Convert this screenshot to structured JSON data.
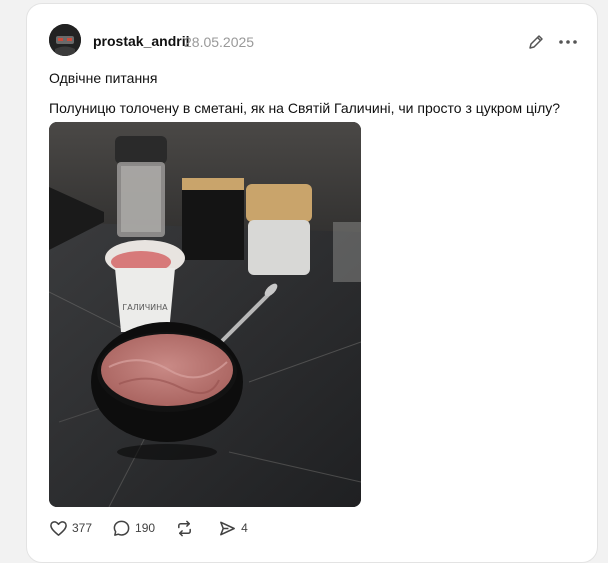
{
  "post": {
    "username": "prostak_andrii",
    "date": "28.05.2025",
    "line1": "Одвічне питання",
    "line2": "Полуницю толочену в сметані, як на Святій Галичині, чи просто з цукром цілу?",
    "image": {
      "description_icon": "photo-image",
      "jar_label": "ГАЛИЧИНА"
    }
  },
  "actions": {
    "likes": "377",
    "comments": "190",
    "repost": "",
    "shares": "4"
  },
  "icons": {
    "edit": "pencil-icon",
    "more": "more-horizontal-icon",
    "like": "heart-icon",
    "comment": "comment-icon",
    "repost": "repost-icon",
    "share": "send-icon"
  },
  "colors": {
    "background": "#f2f2f2",
    "card": "#ffffff",
    "text": "#101010",
    "muted": "#999999"
  }
}
